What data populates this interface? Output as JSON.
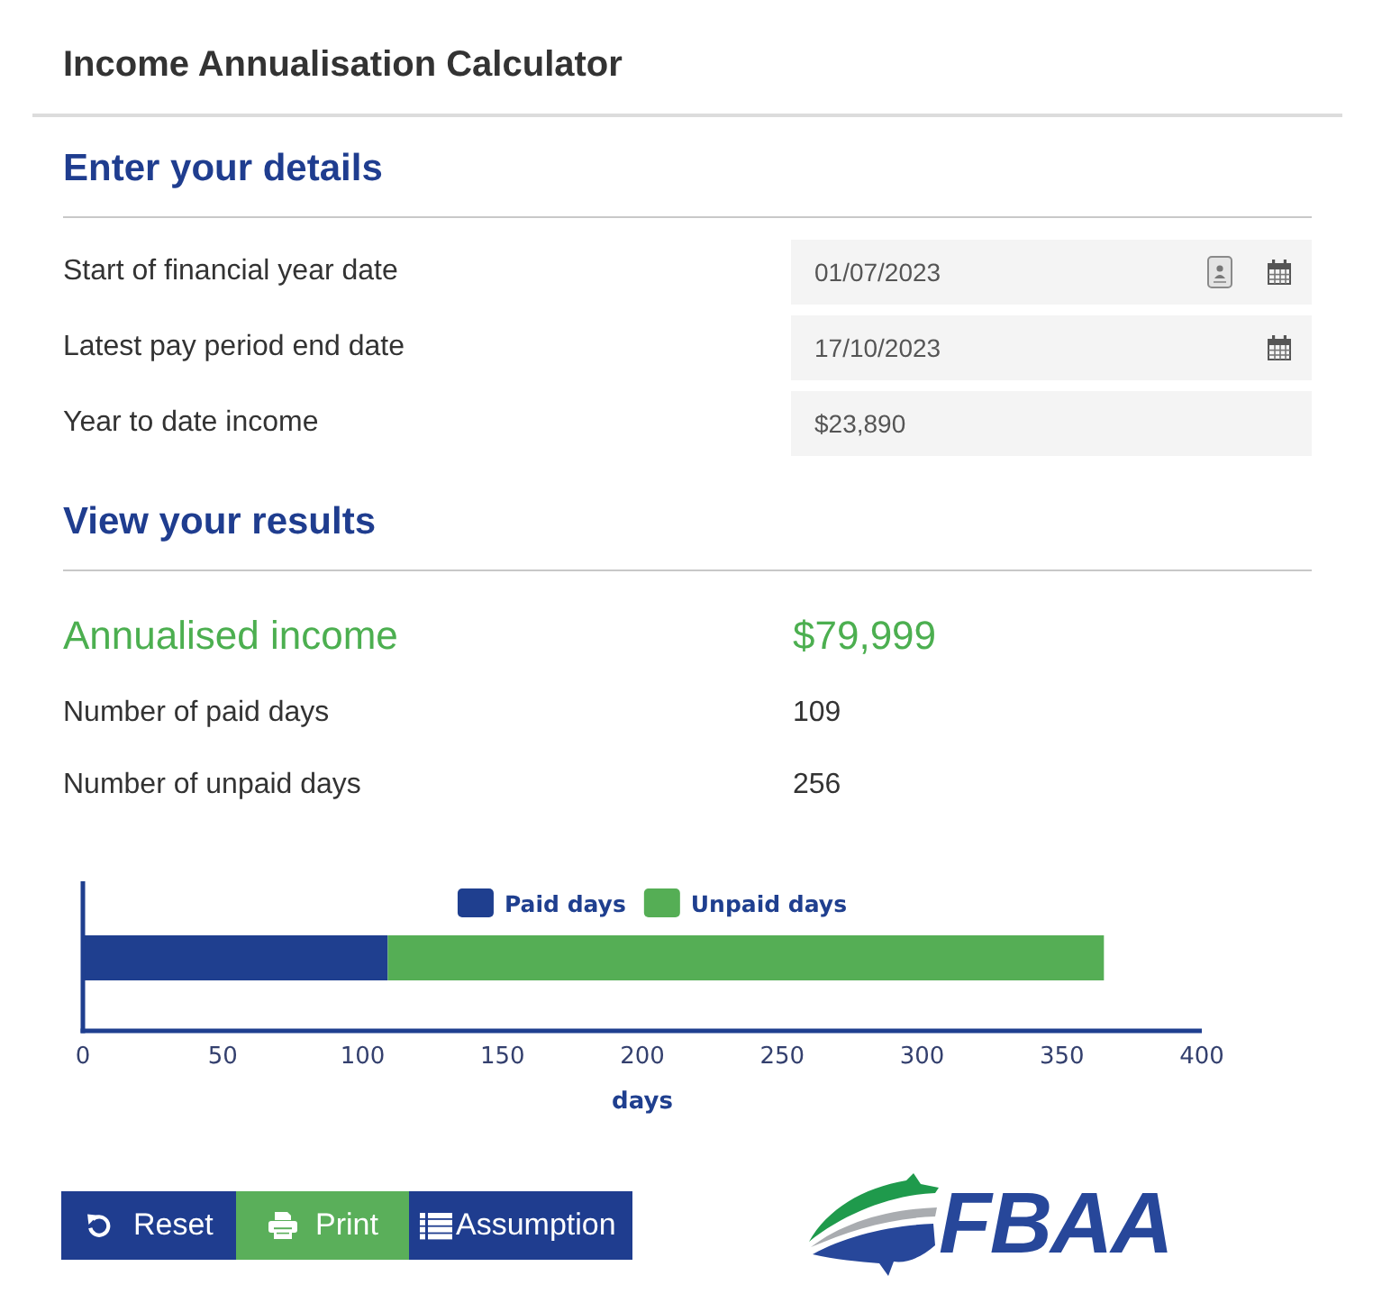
{
  "title": "Income Annualisation Calculator",
  "details": {
    "heading": "Enter your details",
    "fields": [
      {
        "label": "Start of financial year date",
        "kind": "date",
        "value": "01/07/2023",
        "autofill_icon": true
      },
      {
        "label": "Latest pay period end date",
        "kind": "date",
        "value": "17/10/2023",
        "autofill_icon": false
      },
      {
        "label": "Year to date income",
        "kind": "text",
        "value": "$23,890",
        "autofill_icon": false
      }
    ]
  },
  "results": {
    "heading": "View your results",
    "rows": [
      {
        "label": "Annualised income",
        "value": "$79,999",
        "kind": "highlight"
      },
      {
        "label": "Number of paid days",
        "value": "109",
        "kind": "plain"
      },
      {
        "label": "Number of unpaid days",
        "value": "256",
        "kind": "plain"
      }
    ],
    "chart_data": {
      "type": "bar",
      "orientation": "horizontal",
      "stacked": true,
      "legend": "top",
      "xlabel": "days",
      "xlim": [
        0,
        400
      ],
      "xticks": [
        0,
        50,
        100,
        150,
        200,
        250,
        300,
        350,
        400
      ],
      "series": [
        {
          "name": "Paid days",
          "color": "#1f3f8f",
          "values": [
            109
          ]
        },
        {
          "name": "Unpaid days",
          "color": "#55ae55",
          "values": [
            256
          ]
        }
      ]
    }
  },
  "buttons": [
    {
      "label": "Reset",
      "kind": "reset",
      "color": "#1f3d8f"
    },
    {
      "label": "Print",
      "kind": "print",
      "color": "#5aaf5a"
    },
    {
      "label": "Assumption",
      "kind": "list",
      "color": "#1f3d8f"
    }
  ],
  "logo": {
    "text": "FBAA"
  }
}
